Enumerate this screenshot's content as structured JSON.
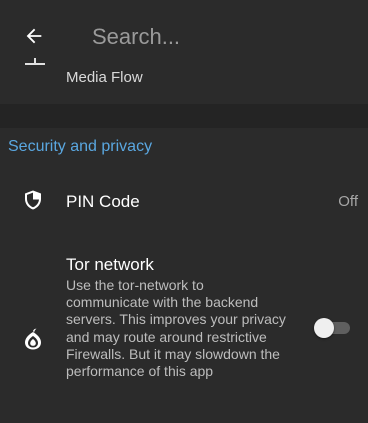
{
  "header": {
    "search_placeholder": "Search..."
  },
  "media_flow": {
    "label": "Media Flow",
    "icon": "media-flow-icon"
  },
  "security_section": {
    "title": "Security and privacy"
  },
  "pin_code": {
    "label": "PIN Code",
    "value": "Off",
    "icon": "shield-icon"
  },
  "tor_network": {
    "title": "Tor network",
    "description": "Use the tor-network to communicate with the backend servers. This improves your privacy and may route around restrictive Firewalls. But it may slowdown the performance of this app",
    "enabled": false,
    "icon": "onion-icon"
  },
  "colors": {
    "background": "#2b2b2b",
    "section_gap": "#242424",
    "accent": "#5aa7e0",
    "secondary_text": "#bdbdbd"
  }
}
